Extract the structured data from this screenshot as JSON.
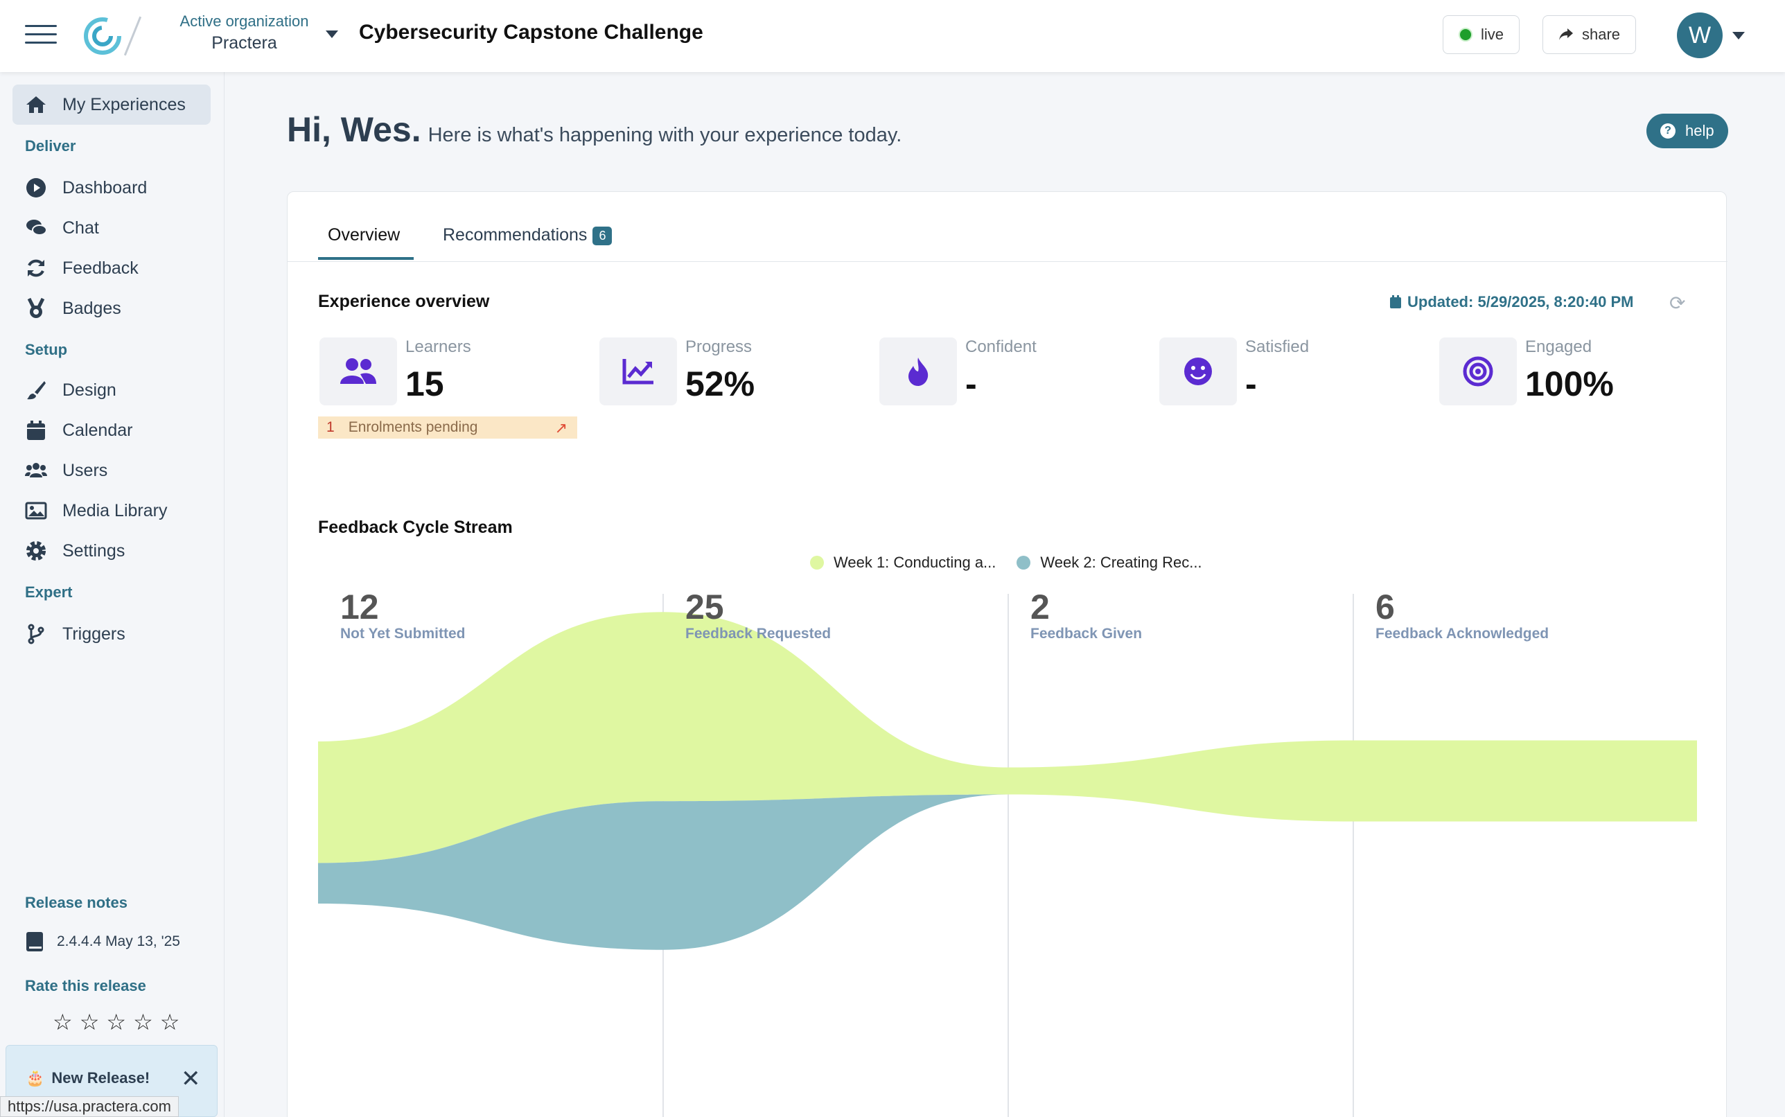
{
  "header": {
    "org_label": "Active organization",
    "org_name": "Practera",
    "experience_title": "Cybersecurity Capstone Challenge",
    "live_label": "live",
    "share_label": "share",
    "avatar_initial": "W"
  },
  "sidebar": {
    "my_experiences": "My Experiences",
    "sections": {
      "deliver": "Deliver",
      "setup": "Setup",
      "expert": "Expert"
    },
    "deliver_items": [
      {
        "label": "Dashboard",
        "icon": "play-circle-icon"
      },
      {
        "label": "Chat",
        "icon": "chat-icon"
      },
      {
        "label": "Feedback",
        "icon": "refresh-icon"
      },
      {
        "label": "Badges",
        "icon": "medal-icon"
      }
    ],
    "setup_items": [
      {
        "label": "Design",
        "icon": "paintbrush-icon"
      },
      {
        "label": "Calendar",
        "icon": "calendar-icon"
      },
      {
        "label": "Users",
        "icon": "users-icon"
      },
      {
        "label": "Media Library",
        "icon": "image-icon"
      },
      {
        "label": "Settings",
        "icon": "gear-icon"
      }
    ],
    "expert_items": [
      {
        "label": "Triggers",
        "icon": "branch-icon"
      }
    ],
    "release_notes_label": "Release notes",
    "release_version": "2.4.4.4 May 13, '25",
    "rate_label": "Rate this release",
    "rating": 0,
    "new_release_label": "New Release!",
    "status_url": "https://usa.practera.com"
  },
  "main": {
    "greeting": "Hi, Wes.",
    "greeting_sub": "Here is what's happening with your experience today.",
    "help_label": "help",
    "tabs": [
      {
        "label": "Overview",
        "active": true
      },
      {
        "label": "Recommendations",
        "badge": "6"
      }
    ],
    "overview_title": "Experience overview",
    "updated": "Updated: 5/29/2025, 8:20:40 PM",
    "stats": [
      {
        "label": "Learners",
        "value": "15",
        "icon": "users-icon"
      },
      {
        "label": "Progress",
        "value": "52%",
        "icon": "chart-line-icon"
      },
      {
        "label": "Confident",
        "value": "-",
        "icon": "flame-icon"
      },
      {
        "label": "Satisfied",
        "value": "-",
        "icon": "smile-icon"
      },
      {
        "label": "Engaged",
        "value": "100%",
        "icon": "target-icon"
      }
    ],
    "enrolments_count": "1",
    "enrolments_label": "Enrolments pending",
    "stream_title": "Feedback Cycle Stream"
  },
  "chart_data": {
    "type": "area",
    "title": "Feedback Cycle Stream",
    "categories": [
      "Not Yet Submitted",
      "Feedback Requested",
      "Feedback Given",
      "Feedback Acknowledged"
    ],
    "totals": [
      12,
      25,
      2,
      6
    ],
    "series": [
      {
        "name": "Week 1: Conducting a...",
        "color": "#dff7a1",
        "values": [
          9,
          14,
          2,
          6
        ]
      },
      {
        "name": "Week 2: Creating Rec...",
        "color": "#8fbfc8",
        "values": [
          3,
          11,
          0,
          0
        ]
      }
    ],
    "accent": "#2f7188",
    "stat_icon_color": "#5b2bd1"
  }
}
